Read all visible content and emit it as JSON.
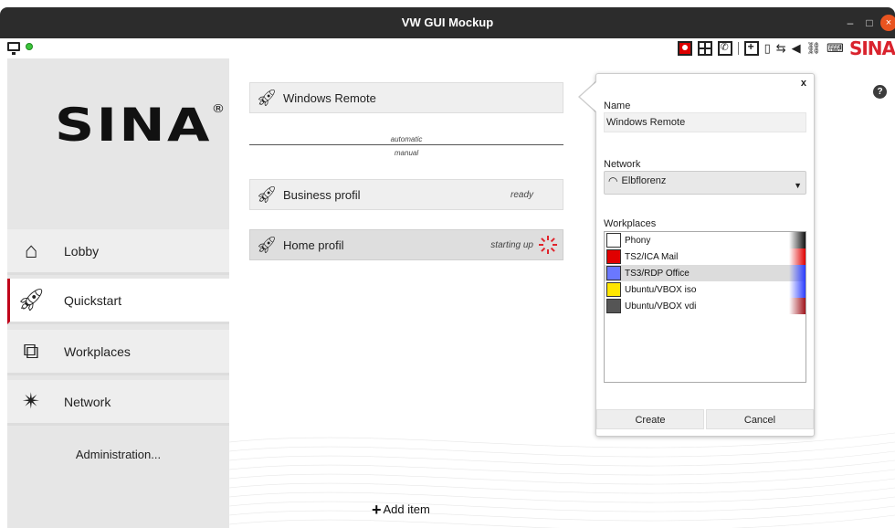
{
  "window": {
    "title": "VW GUI Mockup",
    "minimize": "–",
    "maximize": "□",
    "close": "×"
  },
  "toolbar": {
    "left_icons": [
      "monitor-icon",
      "status-dot-icon"
    ],
    "right_icons": [
      "user-red-icon",
      "grid-icon",
      "phone-icon",
      "screen-add-icon",
      "battery-icon",
      "connection-icon",
      "speaker-icon",
      "network-icon",
      "keyboard-icon"
    ],
    "brand": "SINA"
  },
  "sidebar": {
    "logo": "SINA",
    "logo_mark": "®",
    "items": [
      {
        "label": "Lobby",
        "icon": "home-icon"
      },
      {
        "label": "Quickstart",
        "icon": "rocket-icon"
      },
      {
        "label": "Workplaces",
        "icon": "workplaces-icon"
      },
      {
        "label": "Network",
        "icon": "network-icon"
      }
    ],
    "admin": "Administration..."
  },
  "main": {
    "profiles": [
      {
        "name": "Windows Remote",
        "status": ""
      },
      {
        "name": "Business profil",
        "status": "ready"
      },
      {
        "name": "Home profil",
        "status": "starting up"
      }
    ],
    "mode_automatic": "automatic",
    "mode_manual": "manual",
    "add_item": "Add item",
    "add_icon": "+",
    "help": "?"
  },
  "panel": {
    "close": "x",
    "name_label": "Name",
    "name_value": "Windows Remote",
    "network_label": "Network",
    "network_value": "Elbflorenz",
    "workplaces_label": "Workplaces",
    "workplaces": [
      {
        "name": "Phony",
        "color": "#111111",
        "selected": false
      },
      {
        "name": "TS2/ICA Mail",
        "color": "#e00000",
        "selected": false
      },
      {
        "name": "TS3/RDP Office",
        "color": "#2a3cff",
        "selected": true
      },
      {
        "name": "Ubuntu/VBOX iso",
        "color": "#ffe600",
        "selected": false
      },
      {
        "name": "Ubuntu/VBOX vdi",
        "color": "#333333",
        "selected": false
      }
    ],
    "create": "Create",
    "cancel": "Cancel"
  },
  "colors": {
    "accent": "#c0001a",
    "sina_red": "#d9232d"
  }
}
